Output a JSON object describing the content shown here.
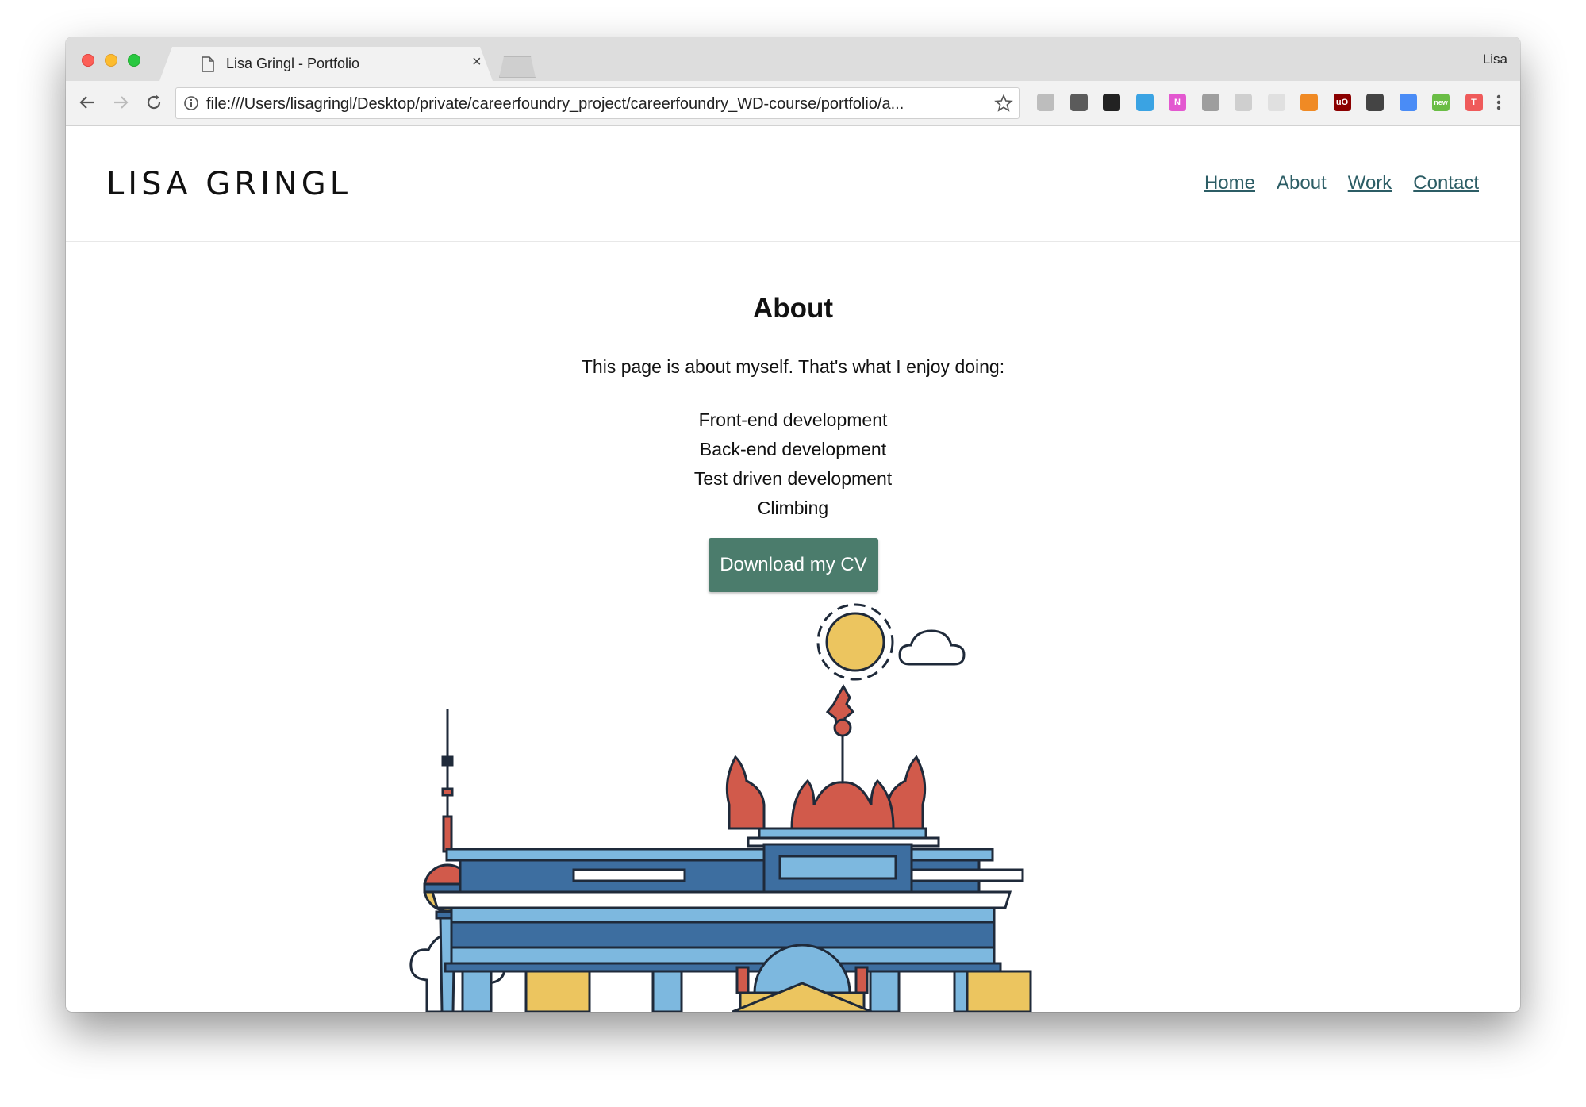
{
  "browser": {
    "tab_title": "Lisa Gringl - Portfolio",
    "tab_close": "×",
    "profile_name": "Lisa",
    "url": "file:///Users/lisagringl/Desktop/private/careerfoundry_project/careerfoundry_WD-course/portfolio/a...",
    "extensions": [
      {
        "name": "umbrella-extension-icon",
        "color": "#bdbdbd"
      },
      {
        "name": "evernote-extension-icon",
        "color": "#5b5b5b"
      },
      {
        "name": "color-picker-extension-icon",
        "color": "#222222"
      },
      {
        "name": "screenshot-extension-icon",
        "color": "#3aa3e3"
      },
      {
        "name": "n-extension-icon",
        "color": "#e358d0",
        "label": "N"
      },
      {
        "name": "puzzle-extension-icon",
        "color": "#9e9e9e"
      },
      {
        "name": "reader-extension-icon",
        "color": "#cfcfcf"
      },
      {
        "name": "moon-extension-icon",
        "color": "#e0e0e0"
      },
      {
        "name": "analytics-extension-icon",
        "color": "#f08a24"
      },
      {
        "name": "ublock-extension-icon",
        "color": "#8b0000",
        "label": "uO"
      },
      {
        "name": "onepassword-extension-icon",
        "color": "#444444"
      },
      {
        "name": "translate-extension-icon",
        "color": "#4a8cf6"
      },
      {
        "name": "new-extension-icon",
        "color": "#6abd45",
        "label": "new"
      },
      {
        "name": "t-extension-icon",
        "color": "#ef5a5a",
        "label": "T"
      }
    ]
  },
  "site": {
    "brand": "LISA GRINGL",
    "nav": [
      "Home",
      "About",
      "Work",
      "Contact"
    ],
    "active_nav": "About"
  },
  "content": {
    "heading": "About",
    "intro": "This page is about myself. That's what I enjoy doing:",
    "interests": [
      "Front-end development",
      "Back-end development",
      "Test driven development",
      "Climbing"
    ],
    "cv_button": "Download my CV"
  },
  "colors": {
    "accent": "#4b7c6c",
    "link": "#2c5d65",
    "illustration_blue": "#3d6ea0",
    "illustration_light_blue": "#7db8df",
    "illustration_red": "#d15a4b",
    "illustration_yellow": "#ecc55f"
  }
}
